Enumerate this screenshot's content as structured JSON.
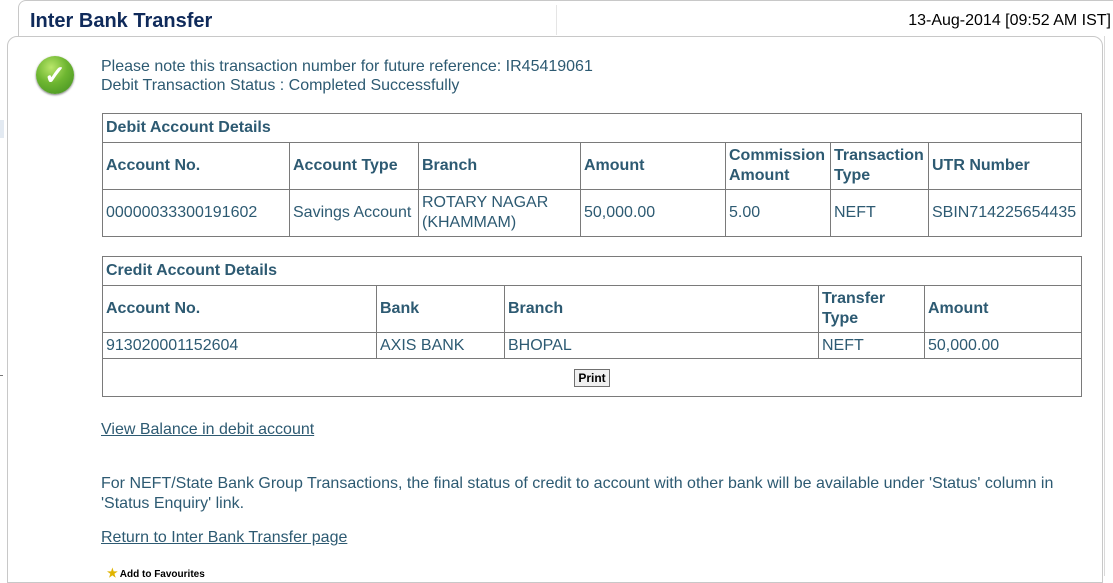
{
  "header": {
    "title": "Inter Bank Transfer",
    "timestamp": "13-Aug-2014 [09:52 AM IST]"
  },
  "notice": {
    "line1": "Please note this transaction number for future reference: IR45419061",
    "line2": "Debit Transaction Status : Completed Successfully"
  },
  "debit": {
    "caption": "Debit Account Details",
    "headers": [
      "Account No.",
      "Account Type",
      "Branch",
      "Amount",
      "Commission Amount",
      "Transaction Type",
      "UTR Number"
    ],
    "row": [
      "00000033300191602",
      "Savings Account",
      "ROTARY NAGAR (KHAMMAM)",
      "50,000.00",
      "5.00",
      "NEFT",
      "SBIN714225654435"
    ]
  },
  "credit": {
    "caption": "Credit Account Details",
    "headers": [
      "Account No.",
      "Bank",
      "Branch",
      "Transfer Type",
      "Amount"
    ],
    "row": [
      "913020001152604",
      "AXIS BANK",
      "BHOPAL",
      "NEFT",
      "50,000.00"
    ],
    "print_label": "Print"
  },
  "links": {
    "view_balance": "View Balance in debit account",
    "return": "Return to Inter Bank Transfer page"
  },
  "note": "For NEFT/State Bank Group Transactions, the final status of credit to account with other bank will be available under 'Status' column in 'Status Enquiry' link.",
  "favorites": {
    "label": "Add to Favourites",
    "icon": "star-icon"
  },
  "icons": {
    "status": "checkmark-icon"
  },
  "colors": {
    "text": "#2d5a72",
    "title": "#0f2a5a",
    "success": "#6eb631"
  }
}
